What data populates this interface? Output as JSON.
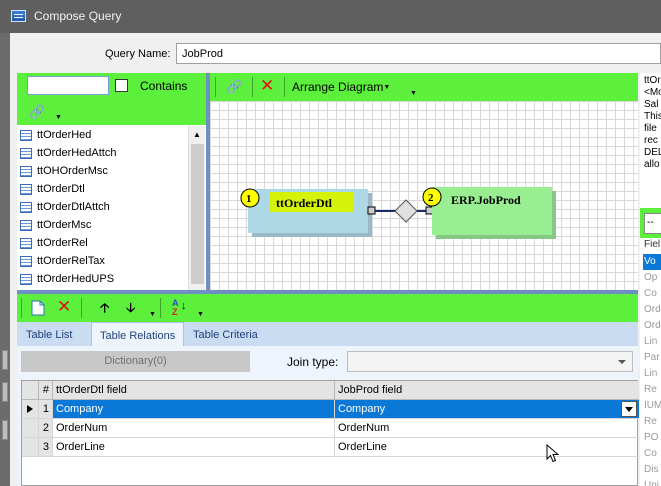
{
  "window": {
    "title": "Compose Query"
  },
  "query_name": {
    "label": "Query Name:",
    "value": "JobProd"
  },
  "table_list": {
    "contains_label": "Contains",
    "items": [
      "ttOrderHed",
      "ttOrderHedAttch",
      "ttOHOrderMsc",
      "ttOrderDtl",
      "ttOrderDtlAttch",
      "ttOrderMsc",
      "ttOrderRel",
      "ttOrderRelTax",
      "ttOrderHedUPS"
    ]
  },
  "diagram": {
    "arrange_label": "Arrange Diagram",
    "node1": {
      "number": "1",
      "name": "ttOrderDtl"
    },
    "node2": {
      "number": "2",
      "name": "ERP.JobProd"
    }
  },
  "right_panel": {
    "text_lines": [
      "ttOr",
      "<Mo",
      "Sal",
      "This",
      "file",
      "rec",
      "DEL",
      "allo"
    ],
    "combo_value": "--",
    "fields_header": "Fiel",
    "fields": [
      "Vo",
      "Op",
      "Co",
      "Ord",
      "Ord",
      "Lin",
      "Par",
      "Lin",
      "Re",
      "IUM",
      "Re",
      "PO",
      "Co",
      "Dis",
      "Uni",
      "Do"
    ]
  },
  "tabs": {
    "table_list": "Table List",
    "table_relations": "Table Relations",
    "table_criteria": "Table Criteria"
  },
  "relations": {
    "dictionary_button": "Dictionary(0)",
    "join_type_label": "Join type:",
    "columns": {
      "num": "#",
      "left": "ttOrderDtl field",
      "right": "JobProd field"
    },
    "rows": [
      {
        "num": "1",
        "left": "Company",
        "right": "Company"
      },
      {
        "num": "2",
        "left": "OrderNum",
        "right": "OrderNum"
      },
      {
        "num": "3",
        "left": "OrderLine",
        "right": "OrderLine"
      }
    ]
  },
  "colors": {
    "toolbar_green": "#5cf03d",
    "selection_blue": "#0a78d7",
    "node1_fill": "#add8e6",
    "node2_fill": "#98ee90",
    "node_label": "#d4f20a"
  }
}
